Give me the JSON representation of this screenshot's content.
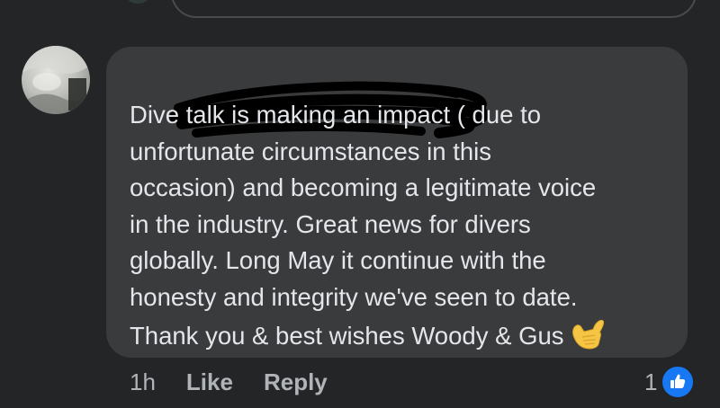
{
  "comment": {
    "lines": [
      "Dive talk is making an impact ( due to",
      "unfortunate circumstances in this",
      "occasion) and becoming a legitimate voice",
      "in the industry. Great news for divers",
      "globally. Long May it continue with the",
      "honesty and integrity we've seen to date.",
      "Thank you & best wishes Woody & Gus"
    ],
    "emoji_icon": "call-me-hand-emoji"
  },
  "actions": {
    "time": "1h",
    "like_label": "Like",
    "reply_label": "Reply"
  },
  "reactions": {
    "count": "1",
    "icon": "thumbs-up-icon",
    "color": "#1877f2"
  },
  "colors": {
    "background": "#242526",
    "bubble": "#3a3b3c",
    "text": "#e4e6eb",
    "muted": "#b0b3b8"
  }
}
